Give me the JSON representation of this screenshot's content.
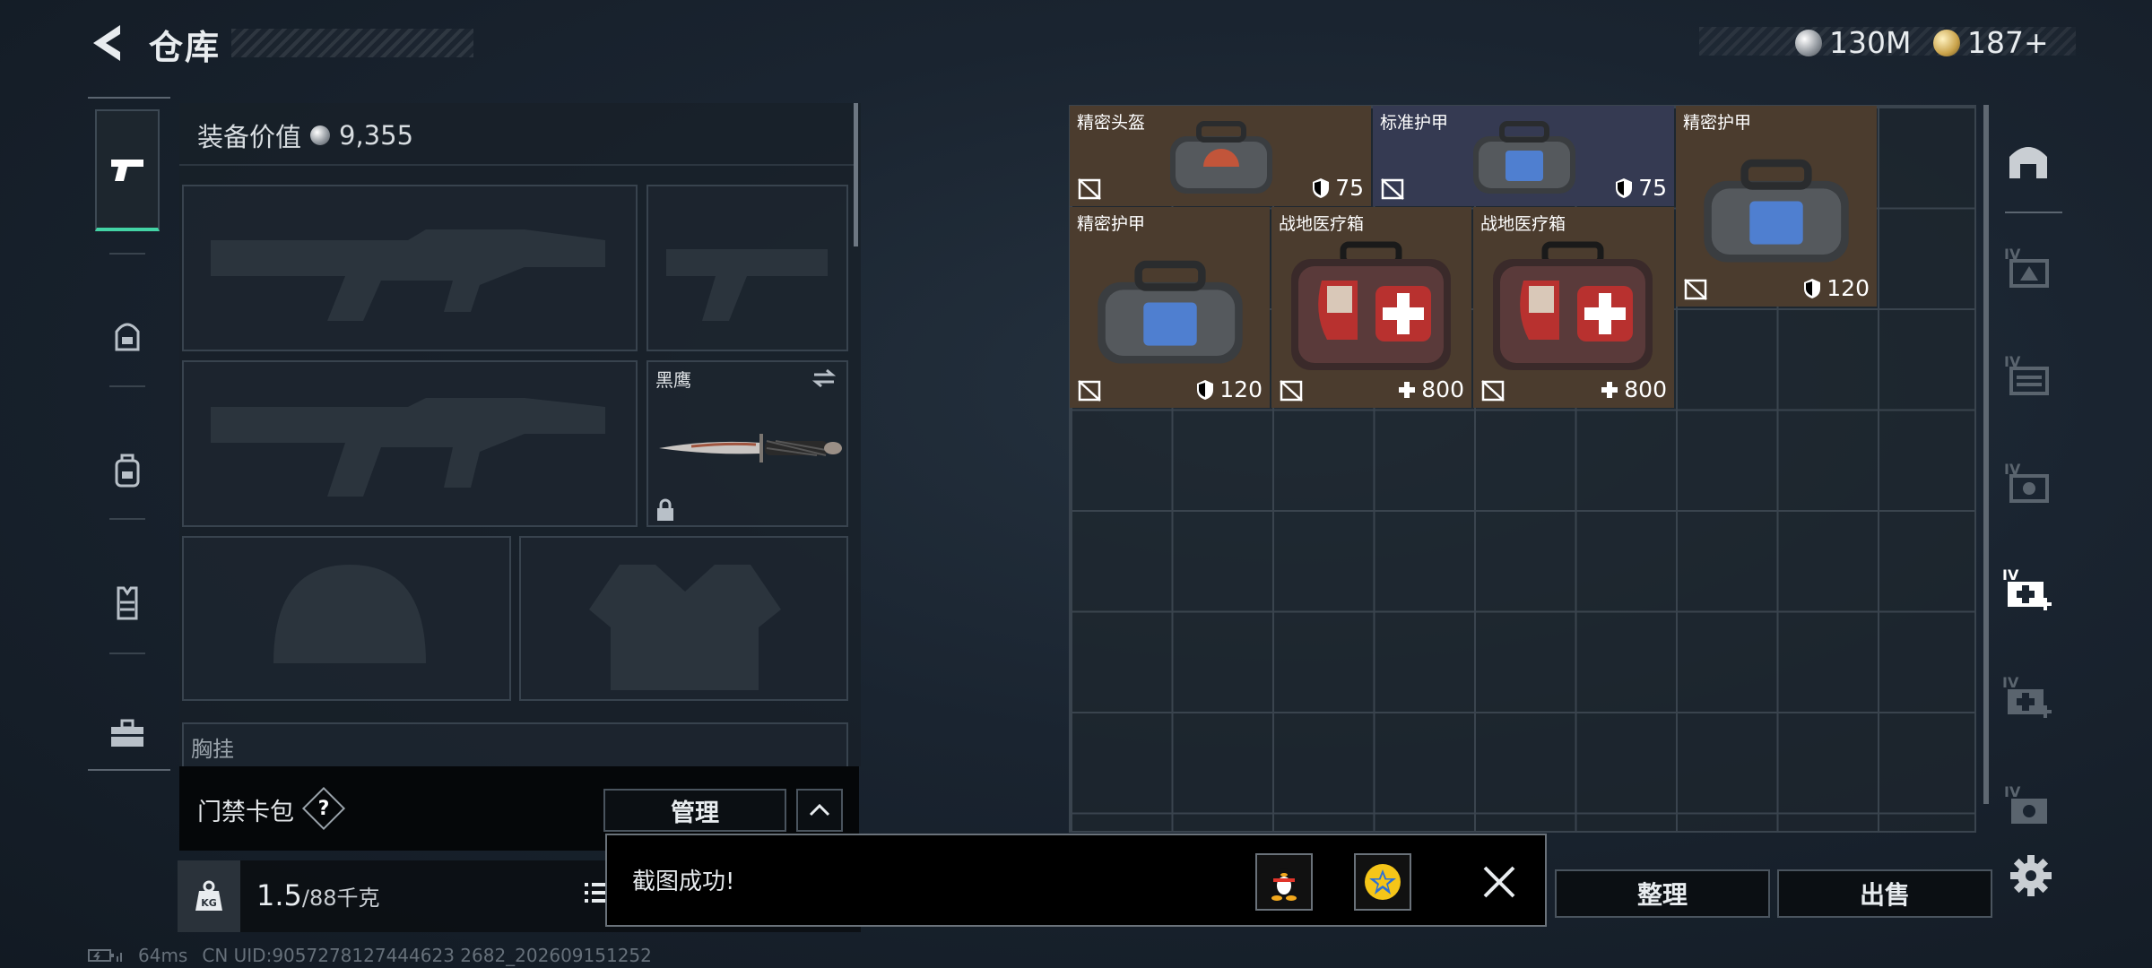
{
  "header": {
    "back_icon": "back-arrow-icon",
    "title": "仓库",
    "currencies": [
      {
        "icon": "silver-coin-icon",
        "value": "130M"
      },
      {
        "icon": "gold-coin-icon",
        "value": "187+"
      }
    ]
  },
  "category_rail": [
    {
      "icon": "pistol-icon",
      "active": true
    },
    {
      "icon": "helmet-armor-icon",
      "active": false
    },
    {
      "icon": "backpack-icon",
      "active": false
    },
    {
      "icon": "vest-icon",
      "active": false
    },
    {
      "icon": "toolbox-icon",
      "active": false
    }
  ],
  "equipment": {
    "value_label": "装备价值",
    "value": "9,355",
    "melee_slot": {
      "name": "黑鹰"
    },
    "chest_rig_label": "胸挂",
    "chest_rig_hint": "?"
  },
  "card_pack": {
    "label": "门禁卡包",
    "help": "?",
    "manage_label": "管理"
  },
  "weight": {
    "icon_text": "KG",
    "current": "1.5",
    "capacity": "/88千克"
  },
  "status_bar": {
    "ping": "64ms",
    "uid": "CN UID:9057278127444623 2682_202609151252"
  },
  "inventory": {
    "items": [
      {
        "name": "精密头盔",
        "stat_icon": "shield-icon",
        "stat": "75",
        "kind": "helmet-bag",
        "bg": "brown"
      },
      {
        "name": "标准护甲",
        "stat_icon": "shield-icon",
        "stat": "75",
        "kind": "armor-bag",
        "bg": "blue"
      },
      {
        "name": "精密护甲",
        "stat_icon": "shield-icon",
        "stat": "120",
        "kind": "armor-bag",
        "bg": "brown"
      },
      {
        "name": "精密护甲",
        "stat_icon": "shield-icon",
        "stat": "120",
        "kind": "armor-bag",
        "bg": "brown"
      },
      {
        "name": "战地医疗箱",
        "stat_icon": "plus-icon",
        "stat": "800",
        "kind": "medkit",
        "bg": "brown"
      },
      {
        "name": "战地医疗箱",
        "stat_icon": "plus-icon",
        "stat": "800",
        "kind": "medkit",
        "bg": "brown"
      }
    ]
  },
  "actions": {
    "sort_label": "整理",
    "sell_label": "出售"
  },
  "toast": {
    "message": "截图成功!",
    "share_qq_icon": "qq-penguin-icon",
    "share_star_icon": "star-badge-icon",
    "close_icon": "close-icon"
  },
  "colors": {
    "accent_green": "#43d3a5",
    "item_brown": "#4b3c2e",
    "item_blue": "#353a52"
  }
}
